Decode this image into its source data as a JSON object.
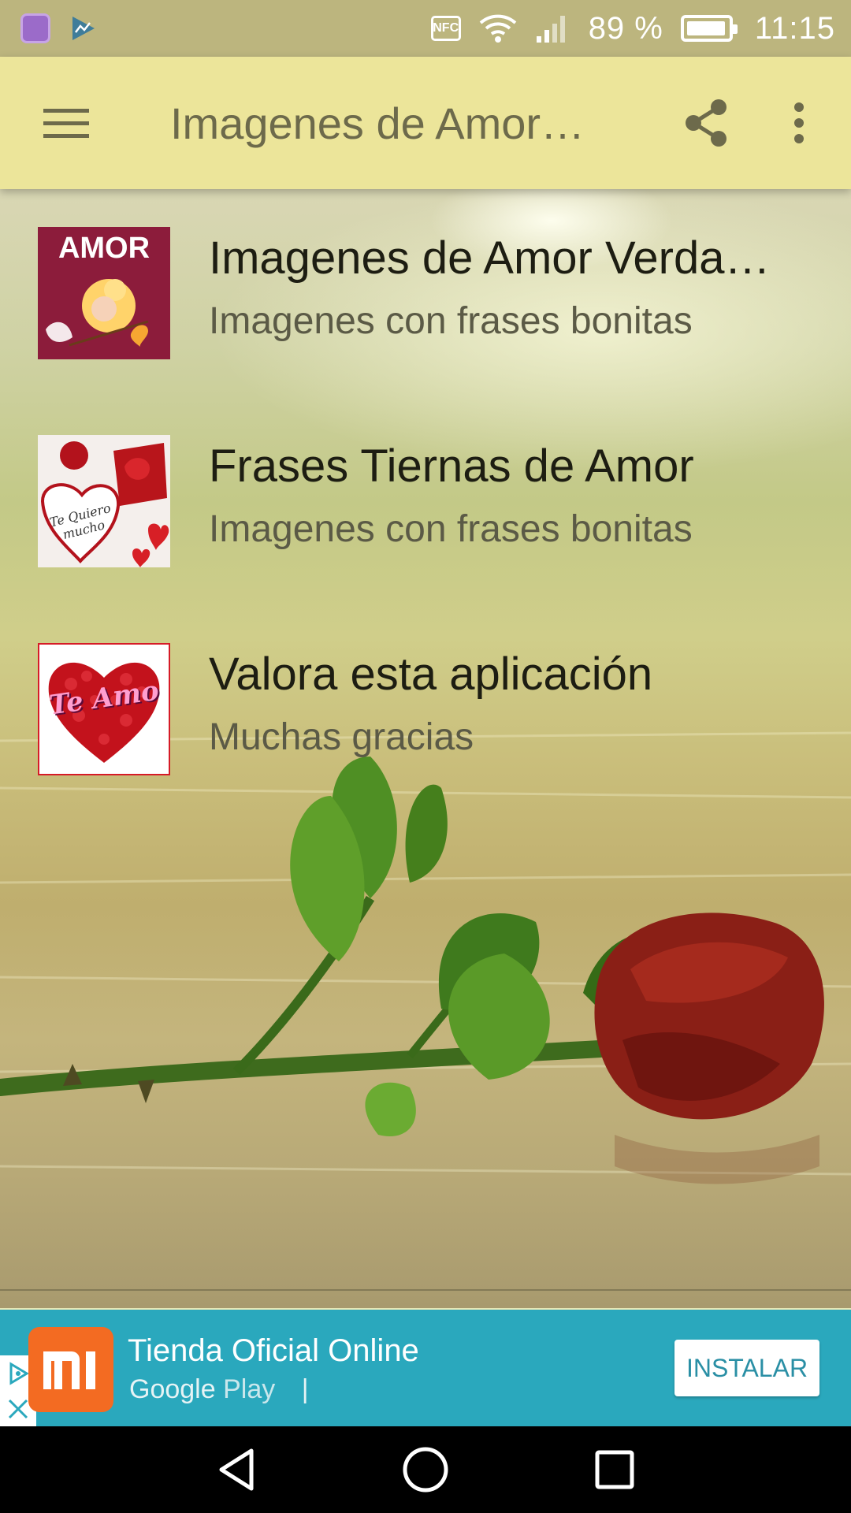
{
  "status_bar": {
    "battery_percent": "89 %",
    "time": "11:15",
    "nfc_label": "NFC",
    "icons": [
      "gallery-icon",
      "ads-icon",
      "nfc-icon",
      "wifi-icon",
      "signal-icon",
      "battery-icon"
    ]
  },
  "app_bar": {
    "title": "Imagenes de Amor…",
    "icons": [
      "menu-icon",
      "share-icon",
      "more-vert-icon"
    ],
    "background": "#ece59a"
  },
  "list": {
    "items": [
      {
        "title": "Imagenes de Amor Verda…",
        "subtitle": "Imagenes con frases bonitas",
        "thumb_text": "AMOR"
      },
      {
        "title": "Frases Tiernas de Amor",
        "subtitle": "Imagenes con frases bonitas",
        "thumb_text": "Te Quiero mucho"
      },
      {
        "title": "Valora esta aplicación",
        "subtitle": "Muchas gracias",
        "thumb_text": "Te Amo"
      }
    ]
  },
  "ad": {
    "title": "Tienda Oficial Online",
    "store_google": "Google",
    "store_play": "Play",
    "store_sep": "|",
    "install_label": "INSTALAR",
    "background": "#2aa8bd",
    "logo_color": "#f36b22"
  },
  "nav_bar": {
    "icons": [
      "back-icon",
      "home-icon",
      "recents-icon"
    ]
  }
}
